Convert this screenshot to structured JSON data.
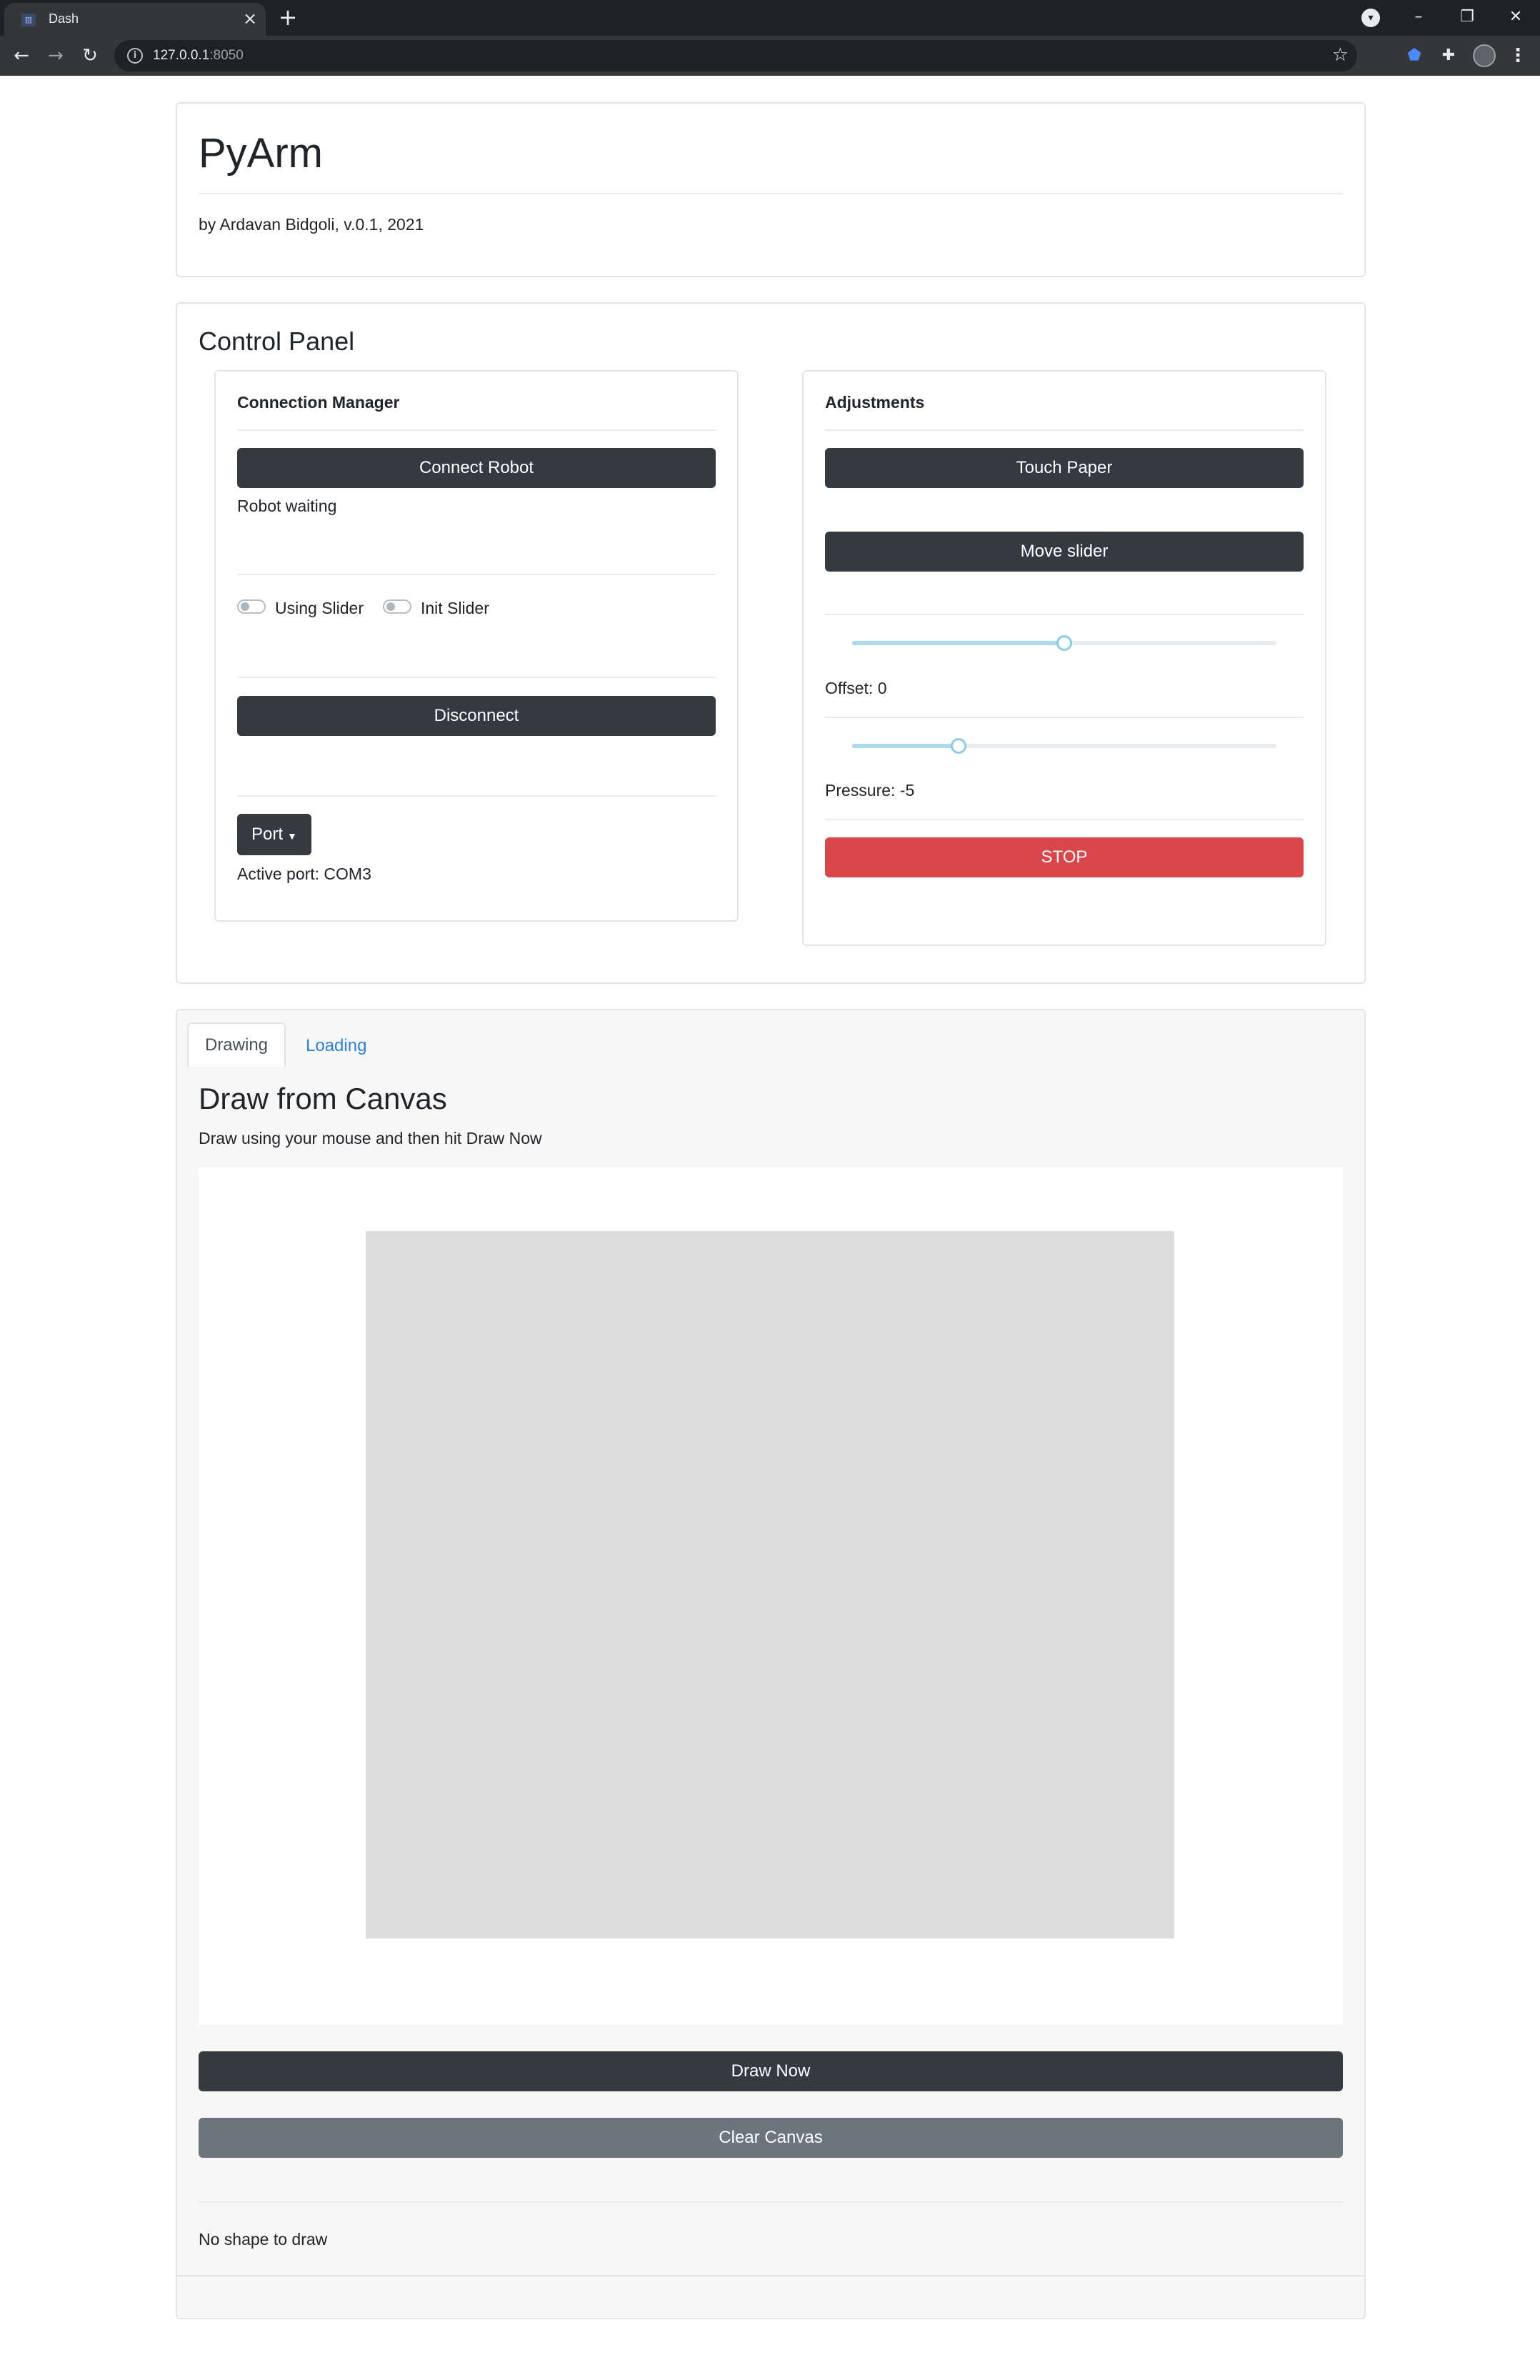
{
  "browser": {
    "tab_title": "Dash",
    "tab_favicon": "dash-favicon",
    "url_host": "127.0.0.1",
    "url_port": ":8050"
  },
  "header": {
    "title": "PyArm",
    "subtitle": "by Ardavan Bidgoli, v.0.1, 2021"
  },
  "control_panel": {
    "title": "Control Panel",
    "connection_manager": {
      "title": "Connection Manager",
      "connect_label": "Connect Robot",
      "status": "Robot waiting",
      "using_slider_label": "Using Slider",
      "using_slider_on": false,
      "init_slider_label": "Init Slider",
      "init_slider_on": false,
      "disconnect_label": "Disconnect",
      "port_label": "Port",
      "active_port": "Active port: COM3"
    },
    "adjustments": {
      "title": "Adjustments",
      "touch_paper_label": "Touch Paper",
      "move_slider_label": "Move slider",
      "offset_slider_fraction": 0.5,
      "offset_label": "Offset: 0",
      "pressure_slider_fraction": 0.25,
      "pressure_label": "Pressure: -5",
      "stop_label": "STOP"
    }
  },
  "drawing_section": {
    "tabs": [
      "Drawing",
      "Loading"
    ],
    "active_tab": "Drawing",
    "title": "Draw from Canvas",
    "instructions": "Draw using your mouse and then hit Draw Now",
    "draw_now_label": "Draw Now",
    "clear_canvas_label": "Clear Canvas",
    "status": "No shape to draw"
  },
  "colors": {
    "dark_button": "#343a40",
    "stop_button": "#d9464b",
    "clear_button": "#6c757d",
    "tab_link": "#2f7fd9",
    "slider_track": "#a9daf0"
  }
}
